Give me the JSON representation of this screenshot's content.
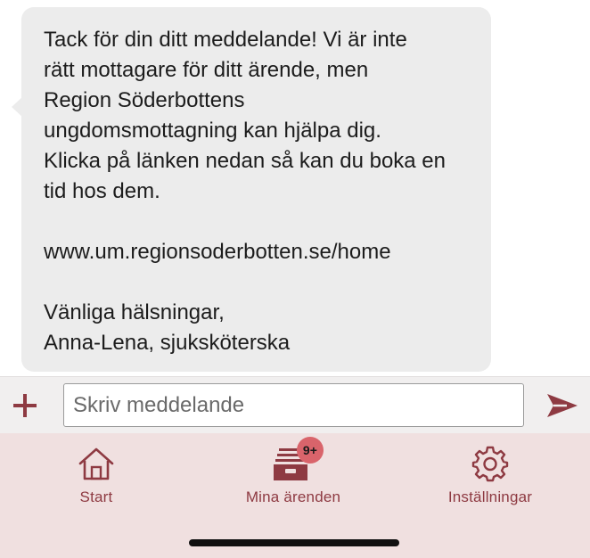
{
  "message": {
    "paragraph1": "Tack för din ditt meddelande! Vi är inte\nrätt mottagare för ditt ärende, men\nRegion Söderbottens\nungdomsmottagning kan hjälpa dig.\nKlicka på länken nedan så kan du boka en\ntid hos dem.",
    "link": "www.um.regionsoderbotten.se/home",
    "greeting": "Vänliga hälsningar,",
    "signature": "Anna-Lena, sjuksköterska"
  },
  "composer": {
    "placeholder": "Skriv meddelande",
    "value": ""
  },
  "tabs": [
    {
      "label": "Start",
      "icon": "home-icon"
    },
    {
      "label": "Mina ärenden",
      "icon": "inbox-tray-icon",
      "badge": "9+"
    },
    {
      "label": "Inställningar",
      "icon": "gear-icon"
    }
  ],
  "colors": {
    "accent": "#8e3a42",
    "bubble": "#ececec",
    "tabbar": "#f0e0e0",
    "badge": "#d9646b"
  }
}
